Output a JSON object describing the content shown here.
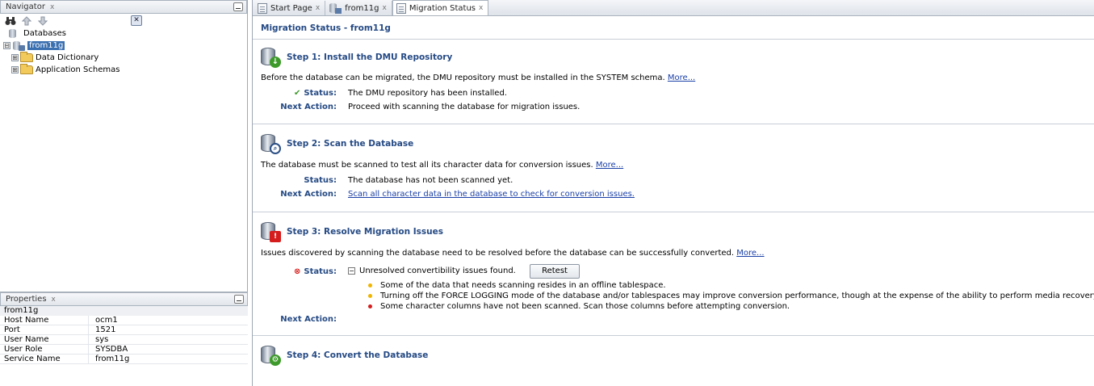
{
  "navigator": {
    "title": "Navigator",
    "close": "x",
    "clear_symbol": "✕",
    "tree": {
      "databases_label": "Databases",
      "db_node": "from11g",
      "children": [
        "Data Dictionary",
        "Application Schemas"
      ],
      "expand_symbol": "⊞",
      "collapse_symbol": "⊟"
    }
  },
  "properties": {
    "title": "Properties",
    "close": "x",
    "object_name": "from11g",
    "rows": [
      {
        "key": "Host Name",
        "value": "ocm1"
      },
      {
        "key": "Port",
        "value": "1521"
      },
      {
        "key": "User Name",
        "value": "sys"
      },
      {
        "key": "User Role",
        "value": "SYSDBA"
      },
      {
        "key": "Service Name",
        "value": "from11g"
      }
    ]
  },
  "tabs": [
    {
      "label": "Start Page",
      "close": "x"
    },
    {
      "label": "from11g",
      "close": "x"
    },
    {
      "label": "Migration Status",
      "close": "x"
    }
  ],
  "page": {
    "title": "Migration Status - from11g",
    "steps": [
      {
        "title": "Step 1: Install the DMU Repository",
        "description": "Before the database can be migrated, the DMU repository must be installed in the SYSTEM schema.",
        "more": "More...",
        "status_label": "Status:",
        "status_value": "The DMU repository has been installed.",
        "next_label": "Next Action:",
        "next_value": "Proceed with scanning the database for migration issues."
      },
      {
        "title": "Step 2: Scan the Database",
        "description": "The database must be scanned to test all its character data for conversion issues.",
        "more": "More...",
        "status_label": "Status:",
        "status_value": "The database has not been scanned yet.",
        "next_label": "Next Action:",
        "next_value": "Scan all character data in the database to check for conversion issues."
      },
      {
        "title": "Step 3: Resolve Migration Issues",
        "description": "Issues discovered by scanning the database need to be resolved before the database can be successfully converted.",
        "more": "More...",
        "status_label": "Status:",
        "status_value": "Unresolved convertibility issues found.",
        "retest_label": "Retest",
        "issues": [
          {
            "text": "Some of the data that needs scanning resides in an offline tablespace.",
            "color": "#f0b400"
          },
          {
            "text": "Turning off the FORCE LOGGING mode of the database and/or tablespaces may improve conversion performance, though at the expense of the ability to perform media recovery.",
            "color": "#f0b400"
          },
          {
            "text": "Some character columns have not been scanned. Scan those columns before attempting conversion.",
            "color": "#d61d1d"
          }
        ],
        "next_label": "Next Action:"
      },
      {
        "title": "Step 4: Convert the Database"
      }
    ]
  },
  "colors": {
    "heading": "#254a84",
    "link": "#1a3fa6",
    "ok": "#3d9a2a",
    "error": "#d61d1d",
    "warning": "#f0b400"
  }
}
